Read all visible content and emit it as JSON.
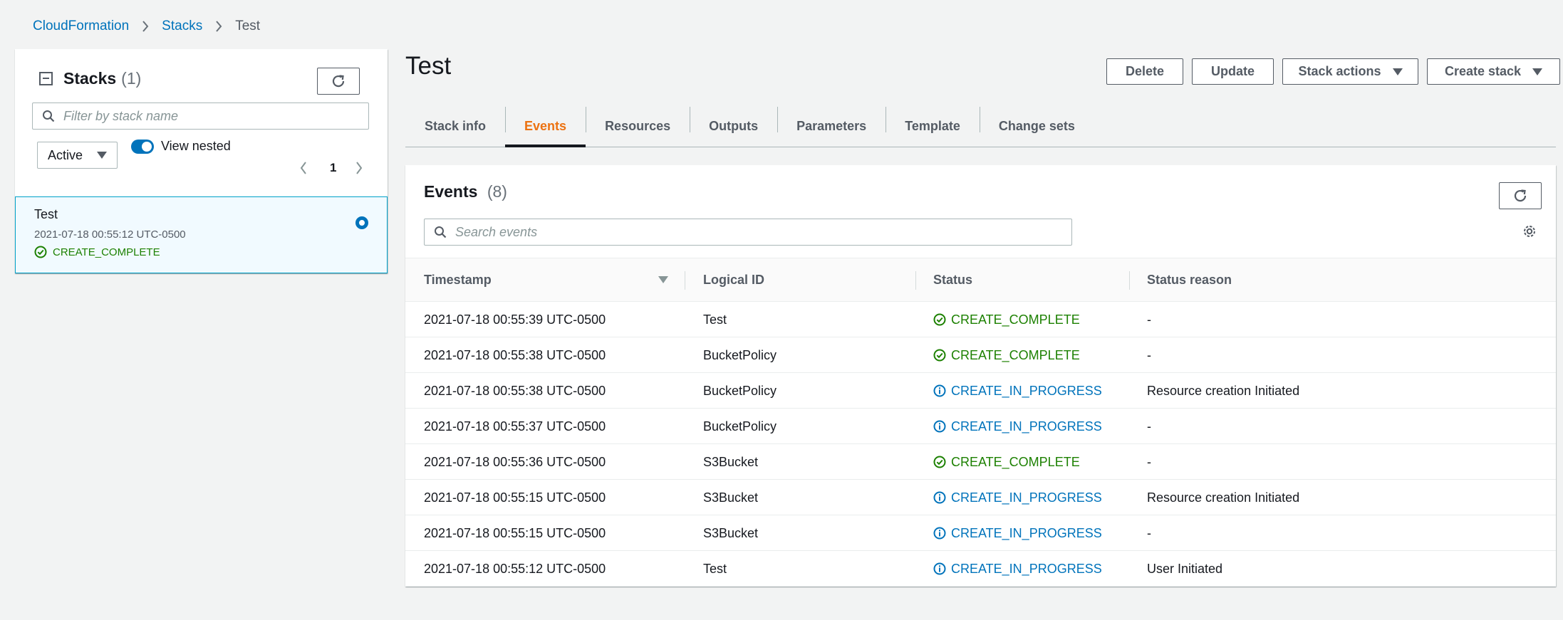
{
  "breadcrumb": {
    "items": [
      "CloudFormation",
      "Stacks",
      "Test"
    ]
  },
  "stacks_panel": {
    "title": "Stacks",
    "count": "(1)",
    "search_placeholder": "Filter by stack name",
    "filter_value": "Active",
    "view_nested_label": "View nested",
    "view_nested_on": true,
    "page": "1",
    "stack": {
      "name": "Test",
      "created": "2021-07-18 00:55:12 UTC-0500",
      "status": "CREATE_COMPLETE"
    }
  },
  "main": {
    "title": "Test",
    "buttons": {
      "delete": "Delete",
      "update": "Update",
      "stack_actions": "Stack actions",
      "create_stack": "Create stack"
    },
    "tabs": [
      "Stack info",
      "Events",
      "Resources",
      "Outputs",
      "Parameters",
      "Template",
      "Change sets"
    ],
    "active_tab": "Events"
  },
  "events": {
    "title": "Events",
    "count": "(8)",
    "search_placeholder": "Search events",
    "columns": [
      "Timestamp",
      "Logical ID",
      "Status",
      "Status reason"
    ],
    "rows": [
      {
        "timestamp": "2021-07-18 00:55:39 UTC-0500",
        "logical_id": "Test",
        "status": "CREATE_COMPLETE",
        "reason": "-"
      },
      {
        "timestamp": "2021-07-18 00:55:38 UTC-0500",
        "logical_id": "BucketPolicy",
        "status": "CREATE_COMPLETE",
        "reason": "-"
      },
      {
        "timestamp": "2021-07-18 00:55:38 UTC-0500",
        "logical_id": "BucketPolicy",
        "status": "CREATE_IN_PROGRESS",
        "reason": "Resource creation Initiated"
      },
      {
        "timestamp": "2021-07-18 00:55:37 UTC-0500",
        "logical_id": "BucketPolicy",
        "status": "CREATE_IN_PROGRESS",
        "reason": "-"
      },
      {
        "timestamp": "2021-07-18 00:55:36 UTC-0500",
        "logical_id": "S3Bucket",
        "status": "CREATE_COMPLETE",
        "reason": "-"
      },
      {
        "timestamp": "2021-07-18 00:55:15 UTC-0500",
        "logical_id": "S3Bucket",
        "status": "CREATE_IN_PROGRESS",
        "reason": "Resource creation Initiated"
      },
      {
        "timestamp": "2021-07-18 00:55:15 UTC-0500",
        "logical_id": "S3Bucket",
        "status": "CREATE_IN_PROGRESS",
        "reason": "-"
      },
      {
        "timestamp": "2021-07-18 00:55:12 UTC-0500",
        "logical_id": "Test",
        "status": "CREATE_IN_PROGRESS",
        "reason": "User Initiated"
      }
    ]
  },
  "colors": {
    "link": "#0073bb",
    "success": "#1d8102",
    "active_tab": "#ec7211",
    "selected_bg": "#f1faff"
  },
  "icons": {
    "refresh": "refresh-icon",
    "search": "search-icon",
    "settings": "gear-icon",
    "success": "check-circle-icon",
    "in_progress": "info-circle-icon"
  }
}
